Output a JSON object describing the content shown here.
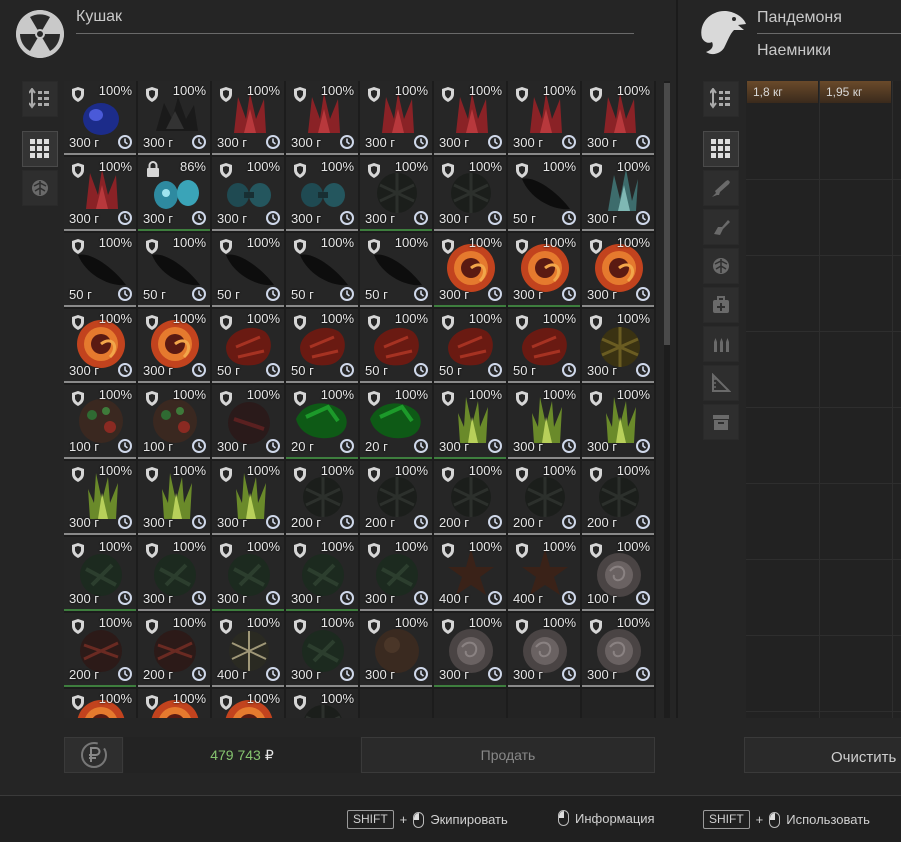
{
  "left_panel": {
    "name": "Кушак",
    "logo_icon": "radiation-icon"
  },
  "right_panel": {
    "name": "Пандемоня",
    "faction": "Наемники",
    "logo_icon": "eagle-icon"
  },
  "inventory": {
    "items": [
      {
        "pct": "100%",
        "w": "300 г",
        "art": "blue-stone"
      },
      {
        "pct": "100%",
        "w": "300 г",
        "art": "dark-crystal"
      },
      {
        "pct": "100%",
        "w": "300 г",
        "art": "red-crystal"
      },
      {
        "pct": "100%",
        "w": "300 г",
        "art": "red-crystal"
      },
      {
        "pct": "100%",
        "w": "300 г",
        "art": "red-crystal"
      },
      {
        "pct": "100%",
        "w": "300 г",
        "art": "red-crystal"
      },
      {
        "pct": "100%",
        "w": "300 г",
        "art": "red-crystal"
      },
      {
        "pct": "100%",
        "w": "300 г",
        "art": "red-crystal"
      },
      {
        "pct": "100%",
        "w": "300 г",
        "art": "red-crystal"
      },
      {
        "pct": "86%",
        "w": "300 г",
        "art": "cyan-stones",
        "locked": true,
        "green": true
      },
      {
        "pct": "100%",
        "w": "300 г",
        "art": "teal-stones"
      },
      {
        "pct": "100%",
        "w": "300 г",
        "art": "teal-stones"
      },
      {
        "pct": "100%",
        "w": "300 г",
        "art": "dark-web",
        "green": true
      },
      {
        "pct": "100%",
        "w": "300 г",
        "art": "dark-web"
      },
      {
        "pct": "100%",
        "w": "50 г",
        "art": "black-leaf"
      },
      {
        "pct": "100%",
        "w": "300 г",
        "art": "ice-crystal"
      },
      {
        "pct": "100%",
        "w": "50 г",
        "art": "black-leaf"
      },
      {
        "pct": "100%",
        "w": "50 г",
        "art": "black-leaf"
      },
      {
        "pct": "100%",
        "w": "50 г",
        "art": "black-leaf"
      },
      {
        "pct": "100%",
        "w": "50 г",
        "art": "black-leaf"
      },
      {
        "pct": "100%",
        "w": "50 г",
        "art": "black-leaf"
      },
      {
        "pct": "100%",
        "w": "300 г",
        "art": "fire-swirl",
        "green": true
      },
      {
        "pct": "100%",
        "w": "300 г",
        "art": "fire-swirl",
        "green": true
      },
      {
        "pct": "100%",
        "w": "300 г",
        "art": "fire-swirl"
      },
      {
        "pct": "100%",
        "w": "300 г",
        "art": "fire-swirl"
      },
      {
        "pct": "100%",
        "w": "300 г",
        "art": "fire-swirl"
      },
      {
        "pct": "100%",
        "w": "50 г",
        "art": "red-rock"
      },
      {
        "pct": "100%",
        "w": "50 г",
        "art": "red-rock"
      },
      {
        "pct": "100%",
        "w": "50 г",
        "art": "red-rock"
      },
      {
        "pct": "100%",
        "w": "50 г",
        "art": "red-rock"
      },
      {
        "pct": "100%",
        "w": "50 г",
        "art": "red-rock"
      },
      {
        "pct": "100%",
        "w": "300 г",
        "art": "gold-web"
      },
      {
        "pct": "100%",
        "w": "100 г",
        "art": "moss-rock"
      },
      {
        "pct": "100%",
        "w": "100 г",
        "art": "moss-rock"
      },
      {
        "pct": "100%",
        "w": "300 г",
        "art": "dark-red-rock"
      },
      {
        "pct": "100%",
        "w": "20 г",
        "art": "green-gem",
        "green": true
      },
      {
        "pct": "100%",
        "w": "20 г",
        "art": "green-gem",
        "green": true
      },
      {
        "pct": "100%",
        "w": "300 г",
        "art": "lime-crystal",
        "green": true
      },
      {
        "pct": "100%",
        "w": "300 г",
        "art": "lime-crystal"
      },
      {
        "pct": "100%",
        "w": "300 г",
        "art": "lime-crystal"
      },
      {
        "pct": "100%",
        "w": "300 г",
        "art": "lime-crystal"
      },
      {
        "pct": "100%",
        "w": "300 г",
        "art": "lime-crystal"
      },
      {
        "pct": "100%",
        "w": "300 г",
        "art": "lime-crystal"
      },
      {
        "pct": "100%",
        "w": "200 г",
        "art": "dark-web"
      },
      {
        "pct": "100%",
        "w": "200 г",
        "art": "dark-web"
      },
      {
        "pct": "100%",
        "w": "200 г",
        "art": "dark-web"
      },
      {
        "pct": "100%",
        "w": "200 г",
        "art": "dark-web"
      },
      {
        "pct": "100%",
        "w": "200 г",
        "art": "dark-web"
      },
      {
        "pct": "100%",
        "w": "300 г",
        "art": "dark-green-rock",
        "green": true
      },
      {
        "pct": "100%",
        "w": "300 г",
        "art": "dark-green-rock"
      },
      {
        "pct": "100%",
        "w": "300 г",
        "art": "dark-green-rock",
        "green": true
      },
      {
        "pct": "100%",
        "w": "300 г",
        "art": "dark-green-rock",
        "green": true
      },
      {
        "pct": "100%",
        "w": "300 г",
        "art": "dark-green-rock"
      },
      {
        "pct": "100%",
        "w": "400 г",
        "art": "dark-star"
      },
      {
        "pct": "100%",
        "w": "400 г",
        "art": "dark-star"
      },
      {
        "pct": "100%",
        "w": "100 г",
        "art": "grey-rose"
      },
      {
        "pct": "100%",
        "w": "200 г",
        "art": "dark-red-web",
        "green": true
      },
      {
        "pct": "100%",
        "w": "200 г",
        "art": "dark-red-web"
      },
      {
        "pct": "100%",
        "w": "400 г",
        "art": "bone-web"
      },
      {
        "pct": "100%",
        "w": "300 г",
        "art": "dark-green-rock"
      },
      {
        "pct": "100%",
        "w": "300 г",
        "art": "brown-rock"
      },
      {
        "pct": "100%",
        "w": "300 г",
        "art": "grey-rose",
        "green": true
      },
      {
        "pct": "100%",
        "w": "300 г",
        "art": "grey-rose"
      },
      {
        "pct": "100%",
        "w": "300 г",
        "art": "grey-rose"
      },
      {
        "pct": "100%",
        "w": "",
        "art": "fire-swirl"
      },
      {
        "pct": "100%",
        "w": "",
        "art": "fire-swirl"
      },
      {
        "pct": "100%",
        "w": "",
        "art": "fire-swirl"
      },
      {
        "pct": "100%",
        "w": "",
        "art": "dark-web"
      }
    ]
  },
  "right_items": [
    {
      "weight": "1,8 кг"
    },
    {
      "weight": "1,95 кг"
    }
  ],
  "money": {
    "value": "479 743",
    "currency": "₽"
  },
  "sell_label": "Продать",
  "clear_label": "Очистить",
  "hints": {
    "shift1": "SHIFT",
    "plus1": "+",
    "equip": "Экипировать",
    "info": "Информация",
    "shift2": "SHIFT",
    "plus2": "+",
    "use": "Использовать"
  }
}
